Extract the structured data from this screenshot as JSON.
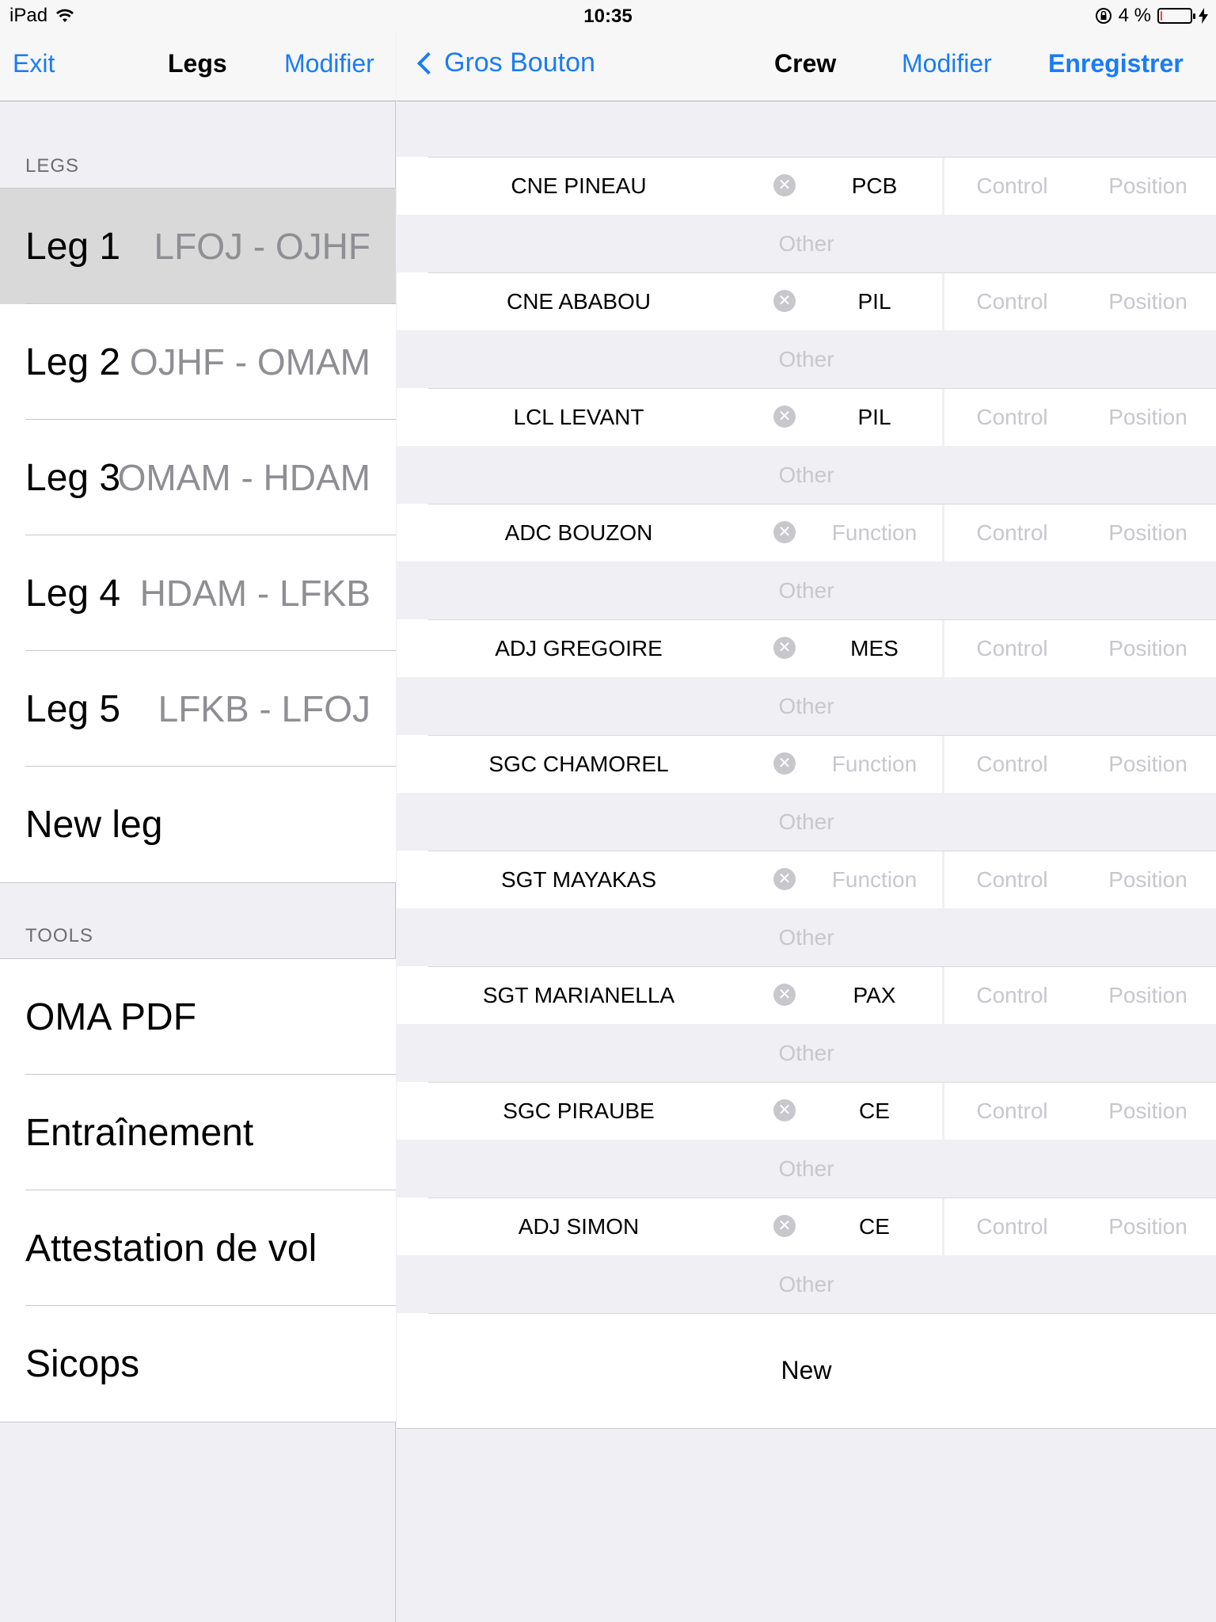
{
  "status_bar": {
    "device": "iPad",
    "time": "10:35",
    "battery_text": "4 %",
    "battery_level": 0.04
  },
  "left_nav": {
    "exit_label": "Exit",
    "title": "Legs",
    "edit_label": "Modifier"
  },
  "legs_section": {
    "header": "LEGS",
    "items": [
      {
        "label": "Leg 1",
        "route": "LFOJ - OJHF",
        "selected": true
      },
      {
        "label": "Leg 2",
        "route": "OJHF - OMAM"
      },
      {
        "label": "Leg 3",
        "route": "OMAM - HDAM"
      },
      {
        "label": "Leg 4",
        "route": "HDAM - LFKB"
      },
      {
        "label": "Leg 5",
        "route": "LFKB - LFOJ"
      },
      {
        "label": "New leg",
        "route": ""
      }
    ]
  },
  "tools_section": {
    "header": "TOOLS",
    "items": [
      {
        "label": "OMA PDF"
      },
      {
        "label": "Entraînement"
      },
      {
        "label": "Attestation de vol"
      },
      {
        "label": "Sicops"
      }
    ]
  },
  "right_nav": {
    "back_label": "Gros Bouton",
    "title": "Crew",
    "edit_label": "Modifier",
    "save_label": "Enregistrer"
  },
  "crew_placeholders": {
    "function": "Function",
    "control": "Control",
    "position": "Position",
    "other": "Other"
  },
  "crew": [
    {
      "name": "CNE PINEAU",
      "function": "PCB"
    },
    {
      "name": "CNE ABABOU",
      "function": "PIL"
    },
    {
      "name": "LCL LEVANT",
      "function": "PIL"
    },
    {
      "name": "ADC BOUZON",
      "function": ""
    },
    {
      "name": "ADJ GREGOIRE",
      "function": "MES"
    },
    {
      "name": "SGC CHAMOREL",
      "function": ""
    },
    {
      "name": "SGT MAYAKAS",
      "function": ""
    },
    {
      "name": "SGT MARIANELLA",
      "function": "PAX"
    },
    {
      "name": "SGC PIRAUBE",
      "function": "CE"
    },
    {
      "name": "ADJ SIMON",
      "function": "CE"
    }
  ],
  "new_crew_label": "New",
  "colors": {
    "accent": "#1a7cf5",
    "placeholder": "#c7c7cd",
    "selected_row": "#d9d9d9",
    "battery_low": "#ff3b30"
  }
}
